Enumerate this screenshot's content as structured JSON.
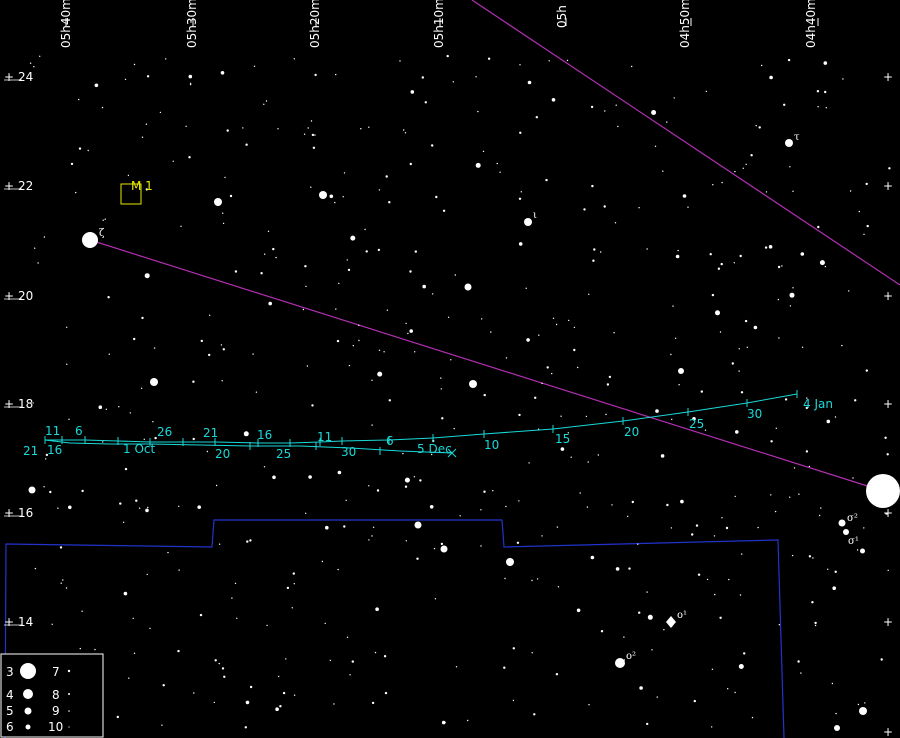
{
  "ra_axis": [
    "05h40m",
    "05h30m",
    "05h20m",
    "05h10m",
    "05h",
    "04h50m",
    "04h40m"
  ],
  "dec_axis": [
    "24",
    "22",
    "20",
    "18",
    "16",
    "14"
  ],
  "dso": {
    "name": "M 1"
  },
  "named_stars": [
    {
      "id": "zeta",
      "label": "ζ"
    },
    {
      "id": "tau",
      "label": "τ"
    },
    {
      "id": "iota",
      "label": "ι"
    },
    {
      "id": "sigma2",
      "label": "σ²"
    },
    {
      "id": "sigma1",
      "label": "σ¹"
    },
    {
      "id": "omicron1",
      "label": "ο¹"
    },
    {
      "id": "omicron2",
      "label": "ο²"
    }
  ],
  "track_upper_labels": [
    "11",
    "6",
    "26",
    "21",
    "16",
    "11",
    "6",
    "1 Oct",
    "20",
    "25",
    "30",
    "5 Dec",
    "10",
    "15",
    "20",
    "25",
    "30",
    "4 Jan"
  ],
  "track_lower_labels": [
    "21",
    "16"
  ],
  "legend": [
    {
      "mag": "3",
      "mag2": "7"
    },
    {
      "mag": "4",
      "mag2": "8"
    },
    {
      "mag": "5",
      "mag2": "9"
    },
    {
      "mag": "6",
      "mag2": "10"
    }
  ],
  "colors": {
    "track": "#19d9d9",
    "ecliptic": "#b22fb2",
    "boundary": "#2233cc",
    "dso": "#e8e800",
    "stars": "#ffffff"
  }
}
